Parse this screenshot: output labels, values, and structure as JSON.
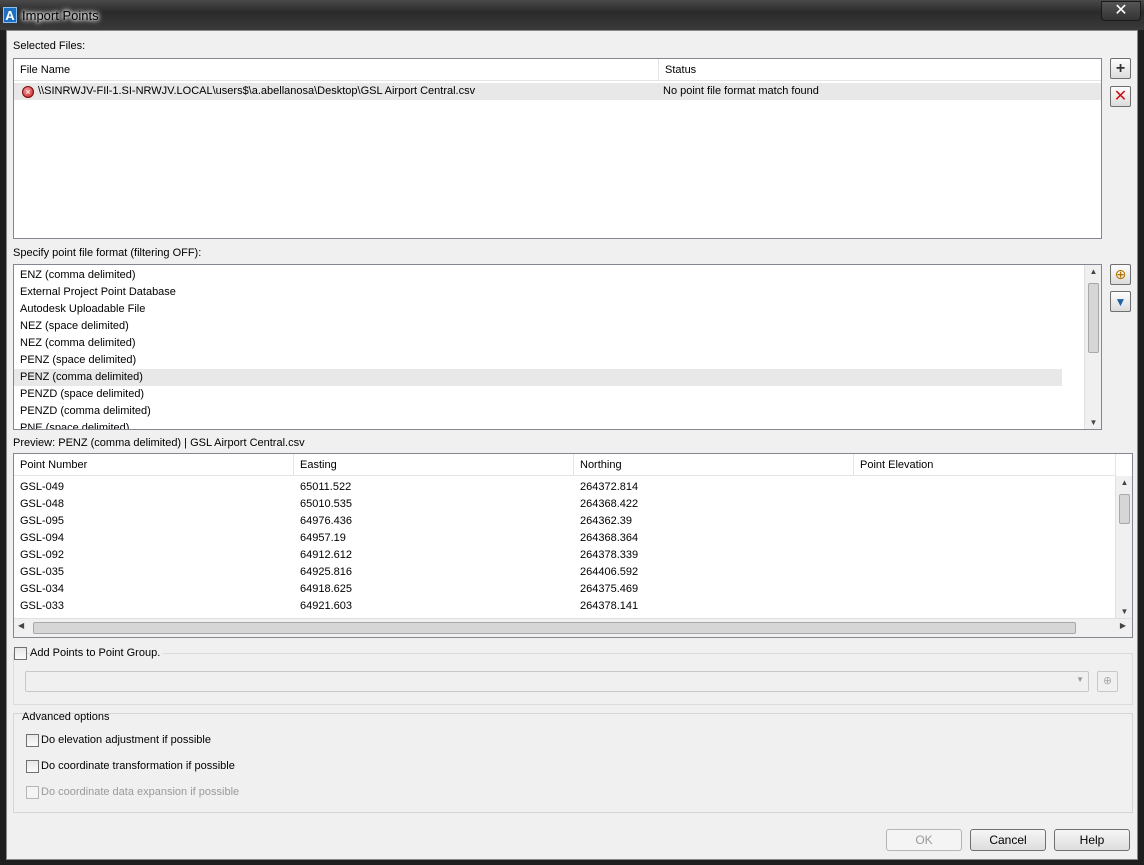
{
  "window": {
    "title": "Import Points",
    "close_glyph": "✕"
  },
  "selected_files": {
    "label": "Selected Files:",
    "columns": [
      "File Name",
      "Status"
    ],
    "rows": [
      {
        "file": "\\\\SINRWJV-FIl-1.SI-NRWJV.LOCAL\\users$\\a.abellanosa\\Desktop\\GSL Airport Central.csv",
        "status": "No point file format match found"
      }
    ]
  },
  "format": {
    "label": "Specify point file format (filtering OFF):",
    "items": [
      "ENZ (comma delimited)",
      "External Project Point Database",
      "Autodesk Uploadable File",
      "NEZ (space delimited)",
      "NEZ (comma delimited)",
      "PENZ (space delimited)",
      "PENZ (comma delimited)",
      "PENZD (space delimited)",
      "PENZD (comma delimited)",
      "PNE (space delimited)"
    ],
    "selected_index": 6
  },
  "preview": {
    "label": "Preview: PENZ (comma delimited) | GSL Airport Central.csv",
    "columns": [
      "Point Number",
      "Easting",
      "Northing",
      "Point Elevation"
    ],
    "rows": [
      [
        "GSL-049",
        "65011.522",
        "264372.814",
        ""
      ],
      [
        "GSL-048",
        "65010.535",
        "264368.422",
        ""
      ],
      [
        "GSL-095",
        "64976.436",
        "264362.39",
        ""
      ],
      [
        "GSL-094",
        "64957.19",
        "264368.364",
        ""
      ],
      [
        "GSL-092",
        "64912.612",
        "264378.339",
        ""
      ],
      [
        "GSL-035",
        "64925.816",
        "264406.592",
        ""
      ],
      [
        "GSL-034",
        "64918.625",
        "264375.469",
        ""
      ],
      [
        "GSL-033",
        "64921.603",
        "264378.141",
        ""
      ]
    ]
  },
  "point_group": {
    "label": "Add Points to Point Group.",
    "value": ""
  },
  "advanced": {
    "title": "Advanced options",
    "options": [
      {
        "label": "Do elevation adjustment if possible",
        "enabled": true
      },
      {
        "label": "Do coordinate transformation if possible",
        "enabled": true
      },
      {
        "label": "Do coordinate data expansion if possible",
        "enabled": false
      }
    ]
  },
  "buttons": {
    "ok": "OK",
    "cancel": "Cancel",
    "help": "Help"
  },
  "colors": {
    "selected_row": "#e8e8e8",
    "error": "#c41818",
    "disabled_text": "#9a9a9a"
  }
}
